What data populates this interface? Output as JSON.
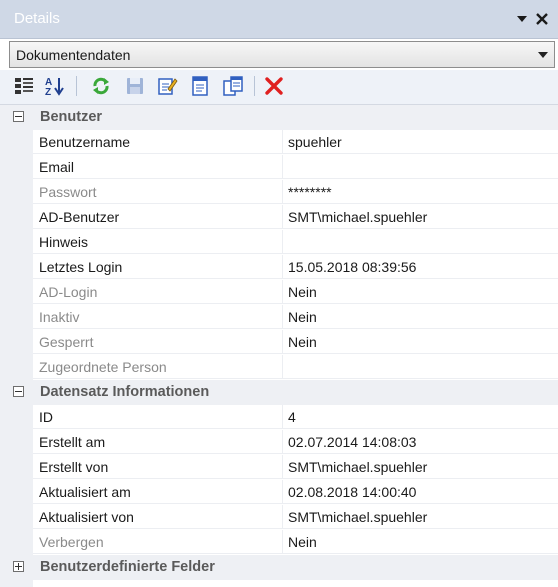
{
  "panel": {
    "title": "Details",
    "pin_icon": "pin-dropdown-icon",
    "close_icon": "close-icon"
  },
  "selector": {
    "value": "Dokumentendaten"
  },
  "toolbar": {
    "buttons": [
      {
        "icon": "categorized-view-icon"
      },
      {
        "icon": "sort-alphabetical-icon"
      },
      {
        "icon": "refresh-icon"
      },
      {
        "icon": "save-icon"
      },
      {
        "icon": "edit-icon"
      },
      {
        "icon": "document-icon"
      },
      {
        "icon": "copy-document-icon"
      },
      {
        "icon": "delete-icon"
      }
    ]
  },
  "categories": {
    "benutzer": {
      "label": "Benutzer",
      "expanded": true
    },
    "datensatz": {
      "label": "Datensatz Informationen",
      "expanded": true
    },
    "felder": {
      "label": "Benutzerdefinierte Felder",
      "expanded": false
    }
  },
  "benutzer_rows": [
    {
      "name": "Benutzername",
      "value": "spuehler",
      "disabled": false
    },
    {
      "name": "Email",
      "value": "",
      "disabled": false
    },
    {
      "name": "Passwort",
      "value": "********",
      "disabled": true
    },
    {
      "name": "AD-Benutzer",
      "value": "SMT\\michael.spuehler",
      "disabled": false
    },
    {
      "name": "Hinweis",
      "value": "",
      "disabled": false
    },
    {
      "name": "Letztes Login",
      "value": "15.05.2018 08:39:56",
      "disabled": false
    },
    {
      "name": "AD-Login",
      "value": "Nein",
      "disabled": true
    },
    {
      "name": "Inaktiv",
      "value": "Nein",
      "disabled": true
    },
    {
      "name": "Gesperrt",
      "value": "Nein",
      "disabled": true
    },
    {
      "name": "Zugeordnete Person",
      "value": "",
      "disabled": true
    }
  ],
  "datensatz_rows": [
    {
      "name": "ID",
      "value": "4",
      "disabled": false
    },
    {
      "name": "Erstellt am",
      "value": "02.07.2014 14:08:03",
      "disabled": false
    },
    {
      "name": "Erstellt von",
      "value": "SMT\\michael.spuehler",
      "disabled": false
    },
    {
      "name": "Aktualisiert am",
      "value": "02.08.2018 14:00:40",
      "disabled": false
    },
    {
      "name": "Aktualisiert von",
      "value": "SMT\\michael.spuehler",
      "disabled": false
    },
    {
      "name": "Verbergen",
      "value": "Nein",
      "disabled": true
    }
  ],
  "colors": {
    "titlebar": "#cfd8e6",
    "gutter": "#eef0f4",
    "disabled_text": "#8a8a8a",
    "delete_red": "#e02020"
  }
}
